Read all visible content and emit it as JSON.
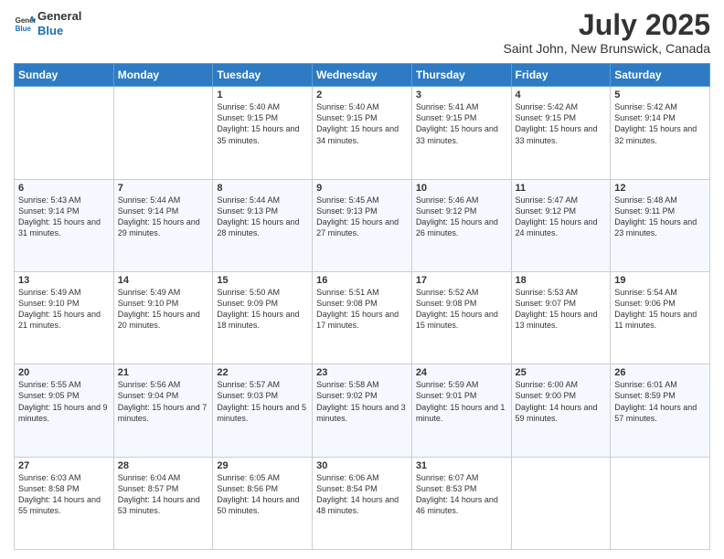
{
  "logo": {
    "line1": "General",
    "line2": "Blue"
  },
  "title": "July 2025",
  "subtitle": "Saint John, New Brunswick, Canada",
  "days_of_week": [
    "Sunday",
    "Monday",
    "Tuesday",
    "Wednesday",
    "Thursday",
    "Friday",
    "Saturday"
  ],
  "weeks": [
    [
      {
        "day": "",
        "info": ""
      },
      {
        "day": "",
        "info": ""
      },
      {
        "day": "1",
        "info": "Sunrise: 5:40 AM\nSunset: 9:15 PM\nDaylight: 15 hours and 35 minutes."
      },
      {
        "day": "2",
        "info": "Sunrise: 5:40 AM\nSunset: 9:15 PM\nDaylight: 15 hours and 34 minutes."
      },
      {
        "day": "3",
        "info": "Sunrise: 5:41 AM\nSunset: 9:15 PM\nDaylight: 15 hours and 33 minutes."
      },
      {
        "day": "4",
        "info": "Sunrise: 5:42 AM\nSunset: 9:15 PM\nDaylight: 15 hours and 33 minutes."
      },
      {
        "day": "5",
        "info": "Sunrise: 5:42 AM\nSunset: 9:14 PM\nDaylight: 15 hours and 32 minutes."
      }
    ],
    [
      {
        "day": "6",
        "info": "Sunrise: 5:43 AM\nSunset: 9:14 PM\nDaylight: 15 hours and 31 minutes."
      },
      {
        "day": "7",
        "info": "Sunrise: 5:44 AM\nSunset: 9:14 PM\nDaylight: 15 hours and 29 minutes."
      },
      {
        "day": "8",
        "info": "Sunrise: 5:44 AM\nSunset: 9:13 PM\nDaylight: 15 hours and 28 minutes."
      },
      {
        "day": "9",
        "info": "Sunrise: 5:45 AM\nSunset: 9:13 PM\nDaylight: 15 hours and 27 minutes."
      },
      {
        "day": "10",
        "info": "Sunrise: 5:46 AM\nSunset: 9:12 PM\nDaylight: 15 hours and 26 minutes."
      },
      {
        "day": "11",
        "info": "Sunrise: 5:47 AM\nSunset: 9:12 PM\nDaylight: 15 hours and 24 minutes."
      },
      {
        "day": "12",
        "info": "Sunrise: 5:48 AM\nSunset: 9:11 PM\nDaylight: 15 hours and 23 minutes."
      }
    ],
    [
      {
        "day": "13",
        "info": "Sunrise: 5:49 AM\nSunset: 9:10 PM\nDaylight: 15 hours and 21 minutes."
      },
      {
        "day": "14",
        "info": "Sunrise: 5:49 AM\nSunset: 9:10 PM\nDaylight: 15 hours and 20 minutes."
      },
      {
        "day": "15",
        "info": "Sunrise: 5:50 AM\nSunset: 9:09 PM\nDaylight: 15 hours and 18 minutes."
      },
      {
        "day": "16",
        "info": "Sunrise: 5:51 AM\nSunset: 9:08 PM\nDaylight: 15 hours and 17 minutes."
      },
      {
        "day": "17",
        "info": "Sunrise: 5:52 AM\nSunset: 9:08 PM\nDaylight: 15 hours and 15 minutes."
      },
      {
        "day": "18",
        "info": "Sunrise: 5:53 AM\nSunset: 9:07 PM\nDaylight: 15 hours and 13 minutes."
      },
      {
        "day": "19",
        "info": "Sunrise: 5:54 AM\nSunset: 9:06 PM\nDaylight: 15 hours and 11 minutes."
      }
    ],
    [
      {
        "day": "20",
        "info": "Sunrise: 5:55 AM\nSunset: 9:05 PM\nDaylight: 15 hours and 9 minutes."
      },
      {
        "day": "21",
        "info": "Sunrise: 5:56 AM\nSunset: 9:04 PM\nDaylight: 15 hours and 7 minutes."
      },
      {
        "day": "22",
        "info": "Sunrise: 5:57 AM\nSunset: 9:03 PM\nDaylight: 15 hours and 5 minutes."
      },
      {
        "day": "23",
        "info": "Sunrise: 5:58 AM\nSunset: 9:02 PM\nDaylight: 15 hours and 3 minutes."
      },
      {
        "day": "24",
        "info": "Sunrise: 5:59 AM\nSunset: 9:01 PM\nDaylight: 15 hours and 1 minute."
      },
      {
        "day": "25",
        "info": "Sunrise: 6:00 AM\nSunset: 9:00 PM\nDaylight: 14 hours and 59 minutes."
      },
      {
        "day": "26",
        "info": "Sunrise: 6:01 AM\nSunset: 8:59 PM\nDaylight: 14 hours and 57 minutes."
      }
    ],
    [
      {
        "day": "27",
        "info": "Sunrise: 6:03 AM\nSunset: 8:58 PM\nDaylight: 14 hours and 55 minutes."
      },
      {
        "day": "28",
        "info": "Sunrise: 6:04 AM\nSunset: 8:57 PM\nDaylight: 14 hours and 53 minutes."
      },
      {
        "day": "29",
        "info": "Sunrise: 6:05 AM\nSunset: 8:56 PM\nDaylight: 14 hours and 50 minutes."
      },
      {
        "day": "30",
        "info": "Sunrise: 6:06 AM\nSunset: 8:54 PM\nDaylight: 14 hours and 48 minutes."
      },
      {
        "day": "31",
        "info": "Sunrise: 6:07 AM\nSunset: 8:53 PM\nDaylight: 14 hours and 46 minutes."
      },
      {
        "day": "",
        "info": ""
      },
      {
        "day": "",
        "info": ""
      }
    ]
  ]
}
